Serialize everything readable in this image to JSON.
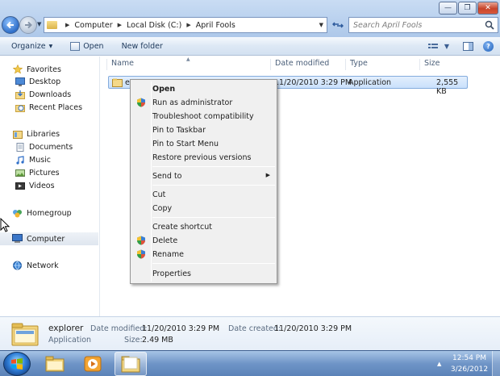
{
  "window": {
    "controls": {
      "minimize": "—",
      "maximize": "❐",
      "close": "✕"
    }
  },
  "address": {
    "crumbs": [
      "Computer",
      "Local Disk (C:)",
      "April Fools"
    ],
    "separator": "▶",
    "dropdown": "▼"
  },
  "search": {
    "placeholder": "Search April Fools"
  },
  "toolbar": {
    "organize_label": "Organize",
    "organize_caret": "▼",
    "open_label": "Open",
    "new_folder_label": "New folder"
  },
  "nav": {
    "favorites_label": "Favorites",
    "favorites": [
      "Desktop",
      "Downloads",
      "Recent Places"
    ],
    "libraries_label": "Libraries",
    "libraries": [
      "Documents",
      "Music",
      "Pictures",
      "Videos"
    ],
    "homegroup_label": "Homegroup",
    "computer_label": "Computer",
    "network_label": "Network"
  },
  "columns": [
    "Name",
    "Date modified",
    "Type",
    "Size"
  ],
  "file": {
    "name": "explorer",
    "name_visible": "ex",
    "date_modified": "11/20/2010 3:29 PM",
    "type": "Application",
    "size": "2,555 KB"
  },
  "context_menu": {
    "open": "Open",
    "run_as_admin": "Run as administrator",
    "troubleshoot": "Troubleshoot compatibility",
    "pin_taskbar": "Pin to Taskbar",
    "pin_start": "Pin to Start Menu",
    "restore": "Restore previous versions",
    "send_to": "Send to",
    "submenu_arrow": "▶",
    "cut": "Cut",
    "copy": "Copy",
    "create_shortcut": "Create shortcut",
    "delete": "Delete",
    "rename": "Rename",
    "properties": "Properties"
  },
  "details": {
    "name": "explorer",
    "type": "Application",
    "date_modified_label": "Date modified:",
    "date_modified": "11/20/2010 3:29 PM",
    "date_created_label": "Date created:",
    "date_created": "11/20/2010 3:29 PM",
    "size_label": "Size:",
    "size": "2.49 MB"
  },
  "taskbar": {
    "time": "12:54 PM",
    "date": "3/26/2012",
    "tray_arrow": "▲"
  },
  "colors": {
    "accent": "#3b5e91",
    "selection": "#c9e0fb",
    "menu_bg": "#f0f0f0"
  }
}
